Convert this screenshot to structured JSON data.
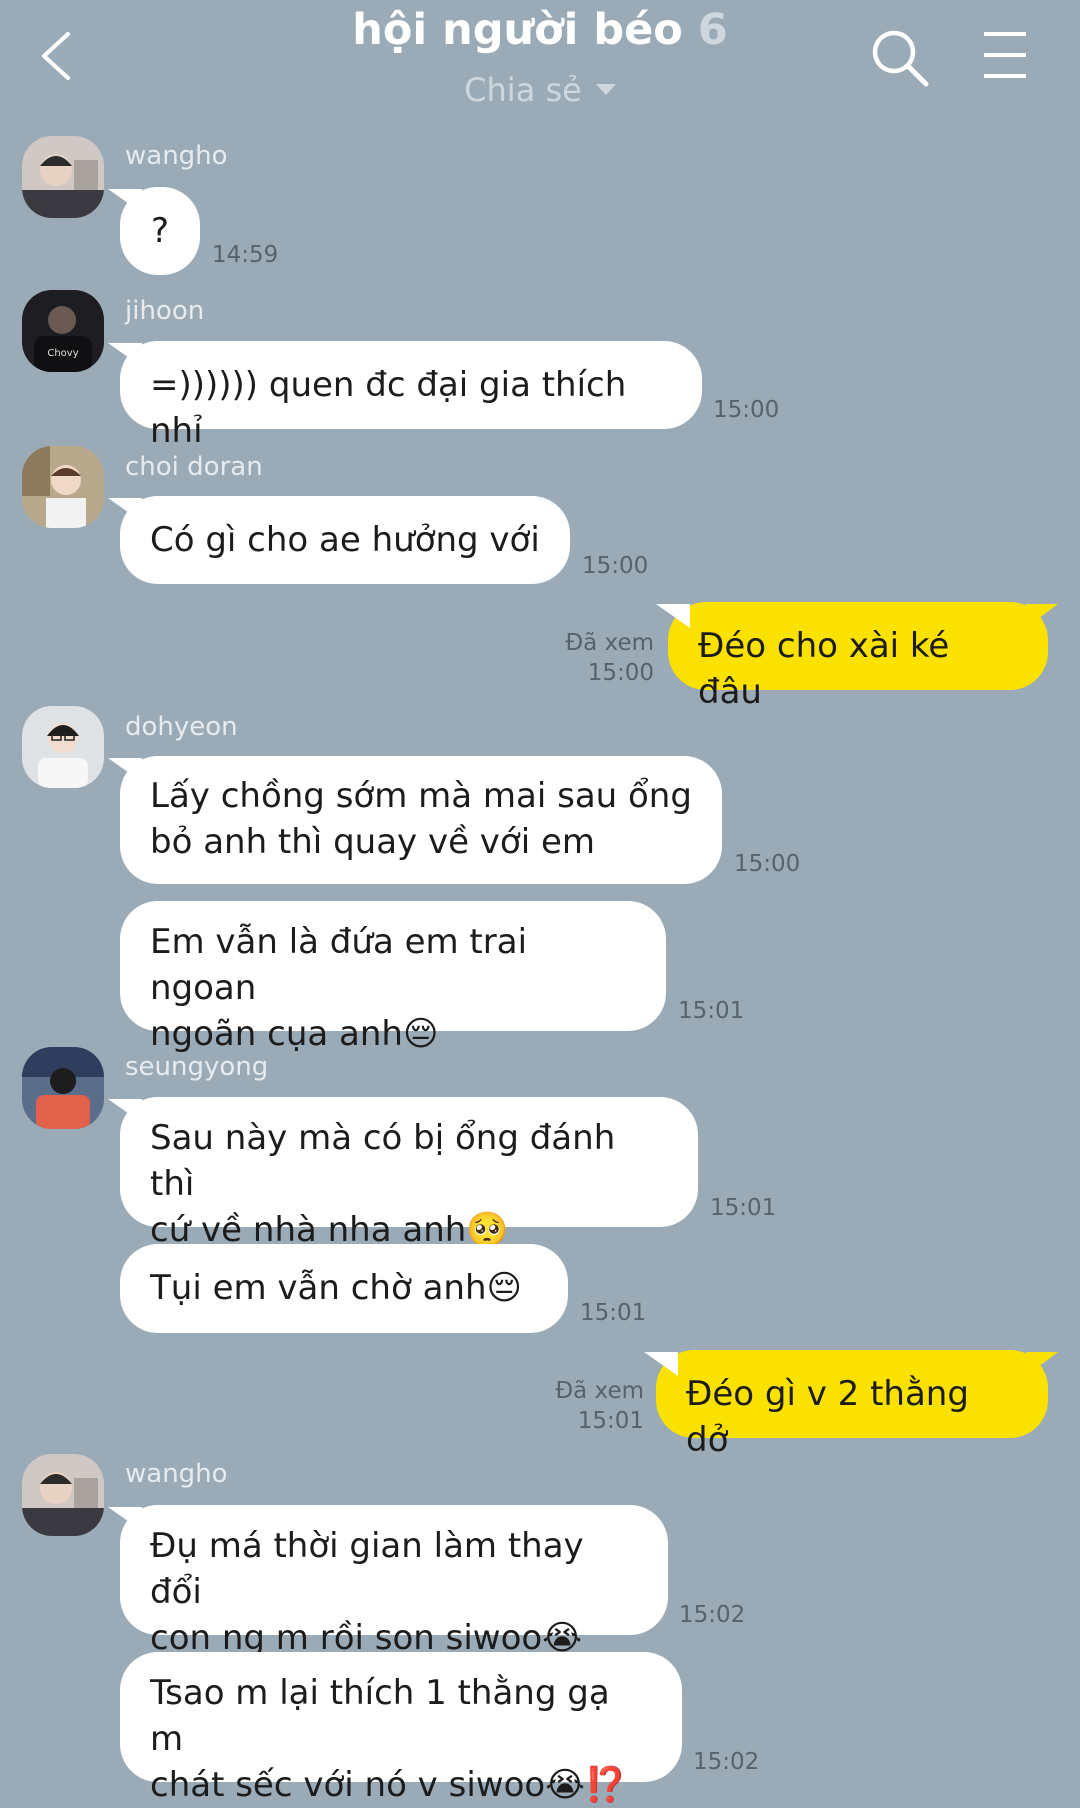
{
  "header": {
    "title": "hội người béo",
    "member_count": "6",
    "subtitle": "Chia sẻ",
    "back_icon": "chevron-left-icon",
    "search_icon": "search-icon",
    "menu_icon": "hamburger-menu-icon"
  },
  "colors": {
    "background": "#9aabb7",
    "incoming_bubble": "#ffffff",
    "outgoing_bubble": "#fae100"
  },
  "messages": [
    {
      "sender": "wangho",
      "text": [
        "?"
      ],
      "time": "14:59"
    },
    {
      "sender": "jihoon",
      "text": [
        "=)))))) quen đc đại gia thích nhỉ"
      ],
      "time": "15:00"
    },
    {
      "sender": "choi doran",
      "text": [
        "Có gì cho ae hưởng với"
      ],
      "time": "15:00"
    },
    {
      "sender": "me",
      "text": [
        "Đéo cho xài ké đâu"
      ],
      "read": "Đã xem",
      "time": "15:00"
    },
    {
      "sender": "dohyeon",
      "text": [
        "Lấy chồng sớm mà mai sau ổng",
        "bỏ anh thì quay về với em"
      ],
      "time": "15:00"
    },
    {
      "sender": "dohyeon",
      "text": [
        "Em vẫn là đứa em trai ngoan",
        "ngoãn cụa anh😔"
      ],
      "time": "15:01"
    },
    {
      "sender": "seungyong",
      "text": [
        "Sau này mà có bị ổng đánh thì",
        "cứ về nhà nha anh🥺"
      ],
      "time": "15:01"
    },
    {
      "sender": "seungyong",
      "text": [
        "Tụi em vẫn chờ anh😔"
      ],
      "time": "15:01"
    },
    {
      "sender": "me",
      "text": [
        "Đéo gì v 2 thằng dở"
      ],
      "read": "Đã xem",
      "time": "15:01"
    },
    {
      "sender": "wangho",
      "text": [
        "Đụ má thời gian làm thay đổi",
        "con ng m rồi son siwoo😭"
      ],
      "time": "15:02"
    },
    {
      "sender": "wangho",
      "text": [
        "Tsao m lại thích 1 thằng gạ m",
        "chát sếc với nó v siwoo😭⁉️"
      ],
      "time": "15:02"
    }
  ]
}
